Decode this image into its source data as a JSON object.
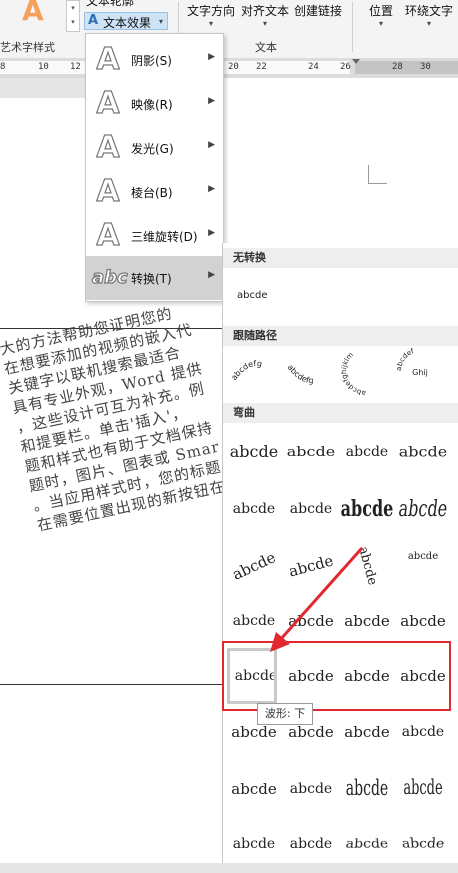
{
  "ribbon": {
    "text_outline": "文本轮廓",
    "text_effects": "文本效果",
    "art_style_group": "艺术字样式",
    "text_direction": "文字方向",
    "align_text": "对齐文本",
    "create_link": "创建链接",
    "text_group": "文本",
    "position": "位置",
    "wrap_text": "环绕文字"
  },
  "ruler": {
    "labels": [
      "8",
      "10",
      "12",
      "20",
      "22",
      "24",
      "26",
      "28",
      "30"
    ]
  },
  "menu": {
    "items": [
      {
        "glyph": "A",
        "label": "阴影(S)"
      },
      {
        "glyph": "A",
        "label": "映像(R)"
      },
      {
        "glyph": "A",
        "label": "发光(G)"
      },
      {
        "glyph": "A",
        "label": "棱台(B)"
      },
      {
        "glyph": "A",
        "label": "三维旋转(D)"
      },
      {
        "glyph": "abc",
        "label": "转换(T)"
      }
    ]
  },
  "gallery": {
    "section_no_transform": "无转换",
    "plain_sample": "abcde",
    "section_follow_path": "跟随路径",
    "path_samples": [
      "abcdefg",
      "abcdefg",
      "abcdefghijklm",
      "Ghij"
    ],
    "section_warp": "弯曲",
    "warp_rows": [
      [
        "abcde",
        "abcde",
        "abcde",
        "abcde"
      ],
      [
        "abcde",
        "abcde",
        "abcde",
        "abcde"
      ],
      [
        "abcde",
        "abcde",
        "abcde",
        "abcde"
      ],
      [
        "abcde",
        "abcde",
        "abcde",
        "abcde"
      ],
      [
        "abcde",
        "abcde",
        "abcde",
        "abcde"
      ],
      [
        "abcde",
        "abcde",
        "abcde",
        "abcde"
      ],
      [
        "abcde",
        "abcde",
        "abcde",
        "abcde"
      ],
      [
        "abcde",
        "abcde",
        "abcde",
        "abcde"
      ]
    ],
    "tooltip": "波形: 下"
  },
  "document": {
    "lines": [
      "大的方法帮助您证明您的",
      "在想要添加的视频的嵌入代",
      "关键字以联机搜索最适合",
      "具有专业外观，Word 提供",
      "，这些设计可互为补充。例",
      "和提要栏。单击'插入'，",
      "题和样式也有助于文档保持",
      "题时，图片、图表或 Smar",
      "。当应用样式时，您的标题",
      "在需要位置出现的新按钮在"
    ]
  }
}
